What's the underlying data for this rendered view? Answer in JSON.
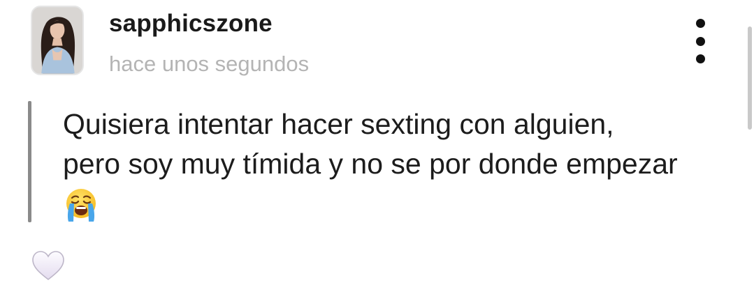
{
  "post": {
    "username": "sapphicszone",
    "timestamp": "hace unos segundos",
    "message_lines": [
      "Quisiera intentar hacer sexting con alguien,",
      "pero soy muy tímida y no se por donde empezar"
    ],
    "emoji": "loudly-crying-face"
  },
  "icons": {
    "avatar": "profile-photo",
    "more": "vertical-ellipsis-icon",
    "like": "heart-icon"
  },
  "colors": {
    "username": "#1a1a1a",
    "timestamp": "#b4b4b4",
    "quote_bar": "#8a8a8a",
    "heart_fill": "#f3f0f7"
  }
}
